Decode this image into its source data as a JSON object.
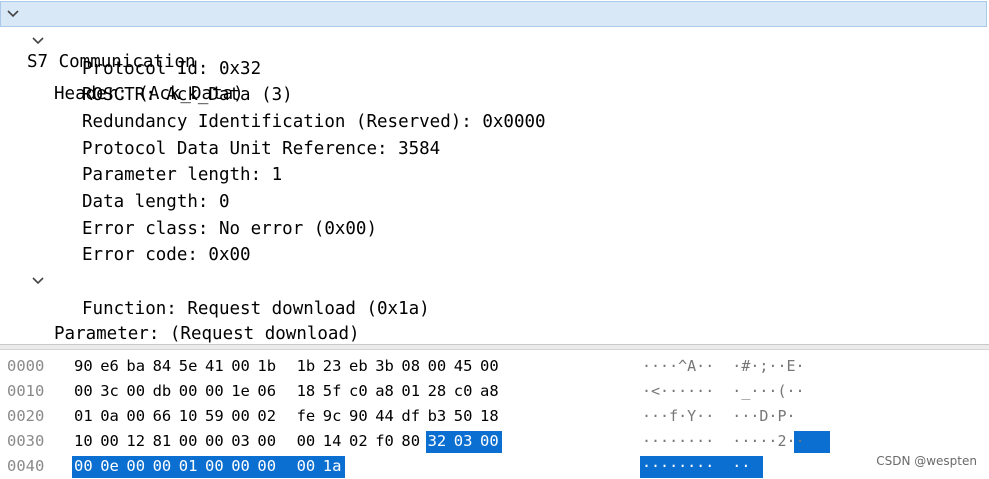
{
  "tree": {
    "s7": "S7 Communication",
    "header": "Header: (Ack_Data)",
    "header_fields": [
      "Protocol Id: 0x32",
      "ROSCTR: Ack_Data (3)",
      "Redundancy Identification (Reserved): 0x0000",
      "Protocol Data Unit Reference: 3584",
      "Parameter length: 1",
      "Data length: 0",
      "Error class: No error (0x00)",
      "Error code: 0x00"
    ],
    "parameter": "Parameter: (Request download)",
    "parameter_fields": [
      "Function: Request download (0x1a)"
    ]
  },
  "hex": {
    "rows": [
      {
        "offset": "0000",
        "bytes": [
          "90",
          "e6",
          "ba",
          "84",
          "5e",
          "41",
          "00",
          "1b",
          "1b",
          "23",
          "eb",
          "3b",
          "08",
          "00",
          "45",
          "00"
        ],
        "ascii": "····^A··  ·#·;··E·"
      },
      {
        "offset": "0010",
        "bytes": [
          "00",
          "3c",
          "00",
          "db",
          "00",
          "00",
          "1e",
          "06",
          "18",
          "5f",
          "c0",
          "a8",
          "01",
          "28",
          "c0",
          "a8"
        ],
        "ascii": "·<······  ·_···(··"
      },
      {
        "offset": "0020",
        "bytes": [
          "01",
          "0a",
          "00",
          "66",
          "10",
          "59",
          "00",
          "02",
          "fe",
          "9c",
          "90",
          "44",
          "df",
          "b3",
          "50",
          "18"
        ],
        "ascii": "···f·Y··  ···D·P·"
      },
      {
        "offset": "0030",
        "bytes": [
          "10",
          "00",
          "12",
          "81",
          "00",
          "00",
          "03",
          "00",
          "00",
          "14",
          "02",
          "f0",
          "80",
          "32",
          "03",
          "00"
        ],
        "ascii": "········  ·····2··"
      },
      {
        "offset": "0040",
        "bytes": [
          "00",
          "0e",
          "00",
          "00",
          "01",
          "00",
          "00",
          "00",
          "00",
          "1a"
        ],
        "ascii": "········  ··"
      }
    ]
  },
  "watermark": "CSDN @wespten",
  "colors": {
    "selection": "#0b6fd1",
    "selected_row": "#d9e8f7"
  }
}
